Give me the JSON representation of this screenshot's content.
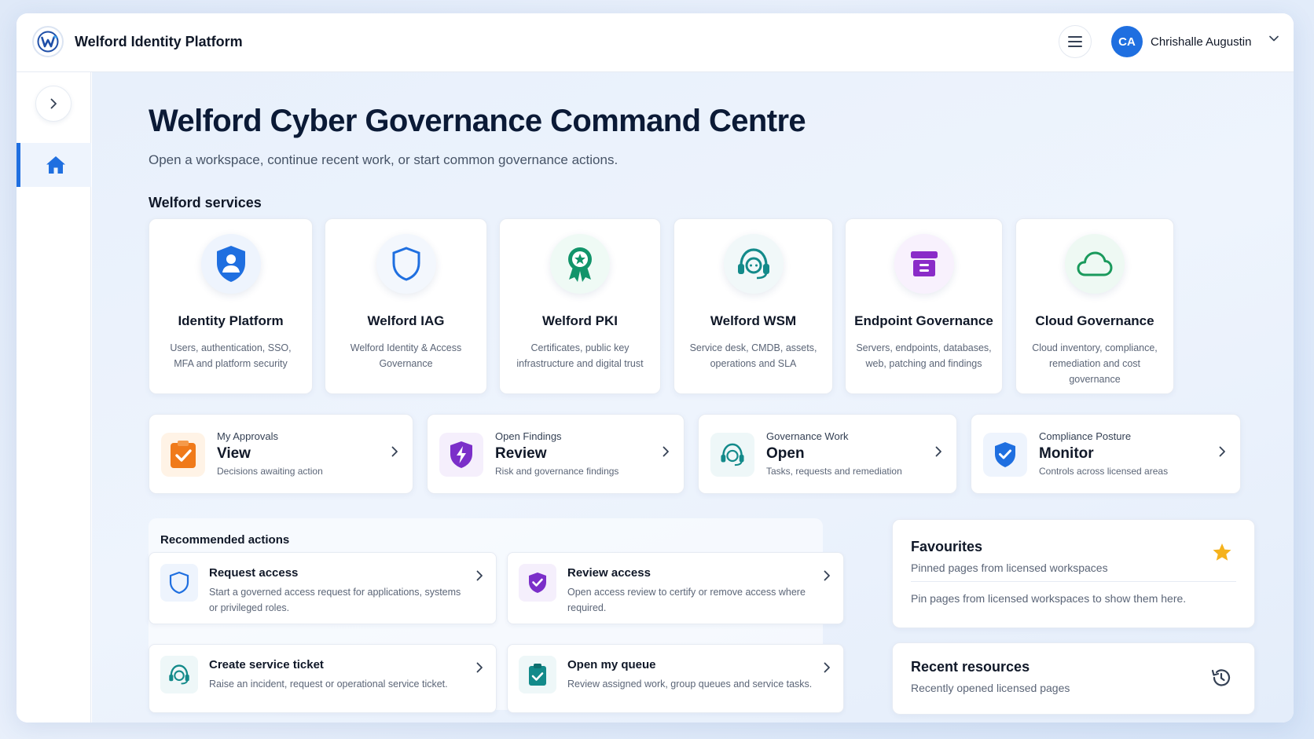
{
  "header": {
    "app_title": "Welford Identity Platform",
    "user_initials": "CA",
    "user_name": "Chrishalle Augustin"
  },
  "main": {
    "title": "Welford Cyber Governance Command Centre",
    "subtitle": "Open a workspace, continue recent work, or start common governance actions.",
    "services_heading": "Welford services"
  },
  "services": [
    {
      "name": "Identity Platform",
      "desc": "Users, authentication, SSO, MFA and platform security",
      "icon": "user-shield-icon",
      "color": "#1f6fe0"
    },
    {
      "name": "Welford IAG",
      "desc": "Welford Identity & Access Governance",
      "icon": "shield-icon",
      "color": "#1f6fe0"
    },
    {
      "name": "Welford PKI",
      "desc": "Certificates, public key infrastructure and digital trust",
      "icon": "award-icon",
      "color": "#12946a"
    },
    {
      "name": "Welford WSM",
      "desc": "Service desk, CMDB, assets, operations and SLA",
      "icon": "headset-icon",
      "color": "#138a8a"
    },
    {
      "name": "Endpoint Governance",
      "desc": "Servers, endpoints, databases, web, patching and findings",
      "icon": "archive-icon",
      "color": "#8a2cc8"
    },
    {
      "name": "Cloud Governance",
      "desc": "Cloud inventory, compliance, remediation and cost governance",
      "icon": "cloud-icon",
      "color": "#1a9a5c"
    }
  ],
  "stats": [
    {
      "small": "My Approvals",
      "big": "View",
      "desc": "Decisions awaiting action",
      "icon": "approval-check-icon",
      "color": "#f07a1a"
    },
    {
      "small": "Open Findings",
      "big": "Review",
      "desc": "Risk and governance findings",
      "icon": "finding-shield-icon",
      "color": "#7b2fc9"
    },
    {
      "small": "Governance Work",
      "big": "Open",
      "desc": "Tasks, requests and remediation",
      "icon": "headset-icon",
      "color": "#138a8a"
    },
    {
      "small": "Compliance Posture",
      "big": "Monitor",
      "desc": "Controls across licensed areas",
      "icon": "check-shield-icon",
      "color": "#1f6fe0"
    }
  ],
  "recommended": {
    "title": "Recommended actions",
    "items": [
      {
        "name": "Request access",
        "desc": "Start a governed access request for applications, systems or privileged roles.",
        "icon": "shield-icon",
        "color": "#1f6fe0"
      },
      {
        "name": "Review access",
        "desc": "Open access review to certify or remove access where required.",
        "icon": "check-shield-icon",
        "color": "#7b2fc9"
      },
      {
        "name": "Create service ticket",
        "desc": "Raise an incident, request or operational service ticket.",
        "icon": "headset-icon",
        "color": "#138a8a"
      },
      {
        "name": "Open my queue",
        "desc": "Review assigned work, group queues and service tasks.",
        "icon": "clipboard-check-icon",
        "color": "#138a8a"
      }
    ]
  },
  "favourites": {
    "title": "Favourites",
    "subtitle": "Pinned pages from licensed workspaces",
    "empty": "Pin pages from licensed workspaces to show them here."
  },
  "recent": {
    "title": "Recent resources",
    "subtitle": "Recently opened licensed pages"
  }
}
